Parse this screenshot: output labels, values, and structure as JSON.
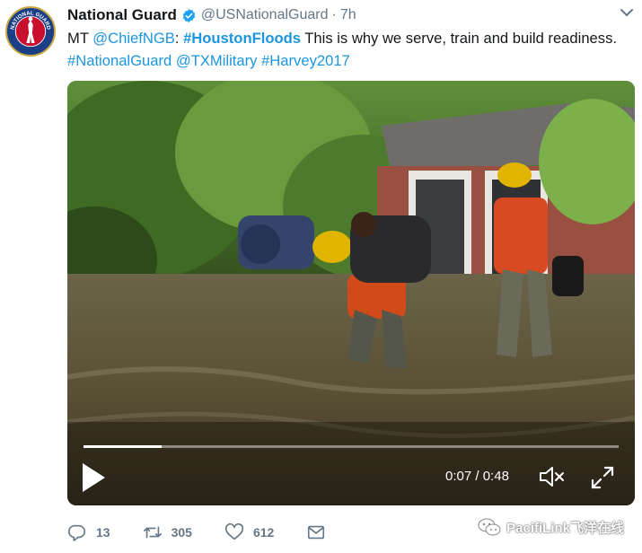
{
  "tweet": {
    "display_name": "National Guard",
    "handle": "@USNationalGuard",
    "separator": "·",
    "time": "7h",
    "text": {
      "prefix": "MT ",
      "mention1": "@ChiefNGB",
      "colon": ": ",
      "hashtag_main": "#HoustonFloods",
      "body": " This is why we serve, train and build readiness.",
      "hashtag2": "#NationalGuard",
      "mention2": "@TXMilitary",
      "hashtag3": "#Harvey2017"
    },
    "avatar_label": "NATIONAL GUARD"
  },
  "video": {
    "current_time": "0:07",
    "duration": "0:48",
    "time_separator": " / ",
    "progress_fraction": 0.146
  },
  "actions": {
    "reply_count": "13",
    "retweet_count": "305",
    "like_count": "612"
  },
  "watermark": {
    "text": "PacifiLink飞洋在线"
  },
  "colors": {
    "link": "#1b95e0",
    "verified": "#1da1f2",
    "secondary_text": "#657786",
    "avatar_bg": "#1b3f86"
  },
  "icons": [
    "verified-icon",
    "caret-down-icon",
    "play-icon",
    "mute-icon",
    "fullscreen-icon",
    "reply-icon",
    "retweet-icon",
    "like-icon",
    "message-icon",
    "wechat-icon"
  ]
}
